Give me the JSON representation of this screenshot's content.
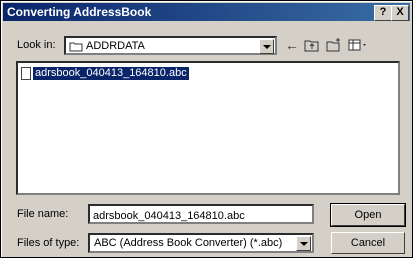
{
  "window": {
    "title": "Converting AddressBook",
    "help_label": "?",
    "close_label": "X"
  },
  "lookin": {
    "label": "Look in:",
    "value": "ADDRDATA"
  },
  "toolbar": {
    "icons": [
      "back-icon",
      "up-folder-icon",
      "new-folder-icon",
      "view-menu-icon"
    ]
  },
  "files": [
    {
      "name": "adrsbook_040413_164810.abc",
      "selected": true
    }
  ],
  "filename": {
    "label": "File name:",
    "value": "adrsbook_040413_164810.abc"
  },
  "filetype": {
    "label": "Files of type:",
    "value": "ABC (Address Book Converter) (*.abc)"
  },
  "buttons": {
    "open": "Open",
    "cancel": "Cancel"
  },
  "colors": {
    "title_bar": "#0a246a",
    "selection": "#0a246a",
    "face": "#d4d0c8"
  }
}
